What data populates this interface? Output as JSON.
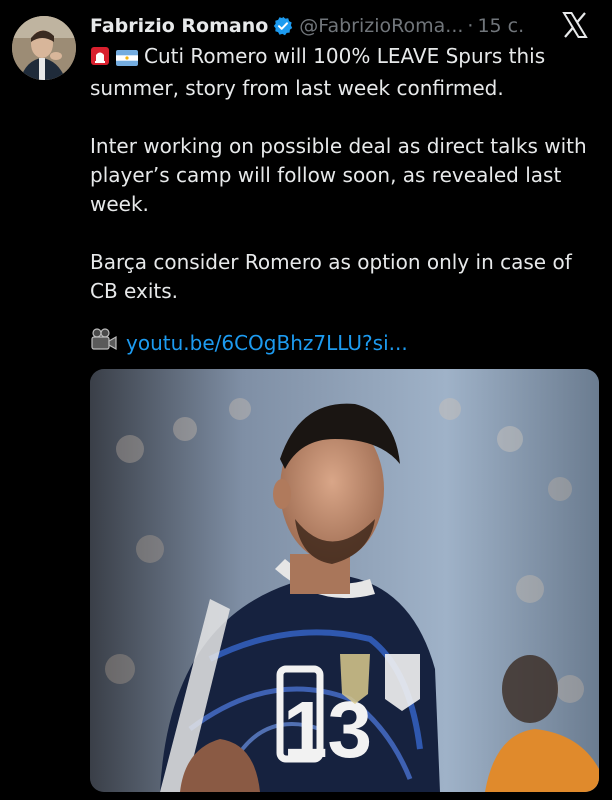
{
  "author": {
    "name": "Fabrizio Romano",
    "handle": "@FabrizioRoma...",
    "separator": "·",
    "time": "15 с."
  },
  "tweet": {
    "line1": "Cuti Romero will 100% LEAVE Spurs this summer, story from last week confirmed.",
    "line2": "Inter working on possible deal as direct talks with player’s camp will follow soon, as revealed last week.",
    "line3": "Barça consider Romero as option only in case of CB exits.",
    "link_text": "youtu.be/6COgBhz7LLU?si..."
  },
  "media": {
    "shirt_number": "13"
  },
  "colors": {
    "link": "#1d9bf0",
    "verified": "#1d9bf0",
    "background": "#000000"
  },
  "icons": [
    "verified-badge-icon",
    "x-logo-icon",
    "siren-emoji-icon",
    "argentina-flag-icon",
    "video-camera-icon"
  ]
}
